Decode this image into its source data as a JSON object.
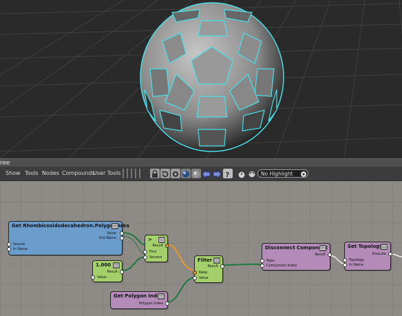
{
  "window": {
    "title_fragment": "ree"
  },
  "menus": [
    "Show",
    "Tools",
    "Nodes",
    "Compounds",
    "User Tools"
  ],
  "toolbar_icons": [
    "lock-icon",
    "refresh-icon",
    "settings-icon",
    "render-icon",
    "sphere-icon",
    "left-arrow-icon",
    "right-arrow-icon",
    "help-icon",
    "timer-icon",
    "cycle-icon"
  ],
  "highlight": {
    "value": "No Highlight"
  },
  "nodes": {
    "get_area": {
      "title": "Get Rhombicosidodecahedron.PolygonArea",
      "ports": [
        "Value",
        "Out Name",
        "Source",
        "In Name"
      ]
    },
    "compare": {
      "title": ">",
      "ports": [
        "Result",
        "First",
        "Second"
      ]
    },
    "scalar": {
      "title": "1.000",
      "ports": [
        "Result",
        "Value"
      ]
    },
    "filter": {
      "title": "Filter",
      "ports": [
        "Result",
        "Keep",
        "Value"
      ]
    },
    "disconnect": {
      "title": "Disconnect Component",
      "ports": [
        "Result",
        "Topo",
        "Component Index"
      ]
    },
    "set_topology": {
      "title": "Set Topology",
      "ports": [
        "Execute",
        "Topology",
        "In Name"
      ]
    },
    "polygon_index": {
      "title": "Get Polygon Index",
      "ports": [
        "Polygon Index"
      ]
    }
  },
  "colors": {
    "wire_green": "#1e7a3e",
    "wire_orange": "#e8952c",
    "wire_white": "#f2f2f2",
    "mesh_cyan": "#48e0e8"
  }
}
